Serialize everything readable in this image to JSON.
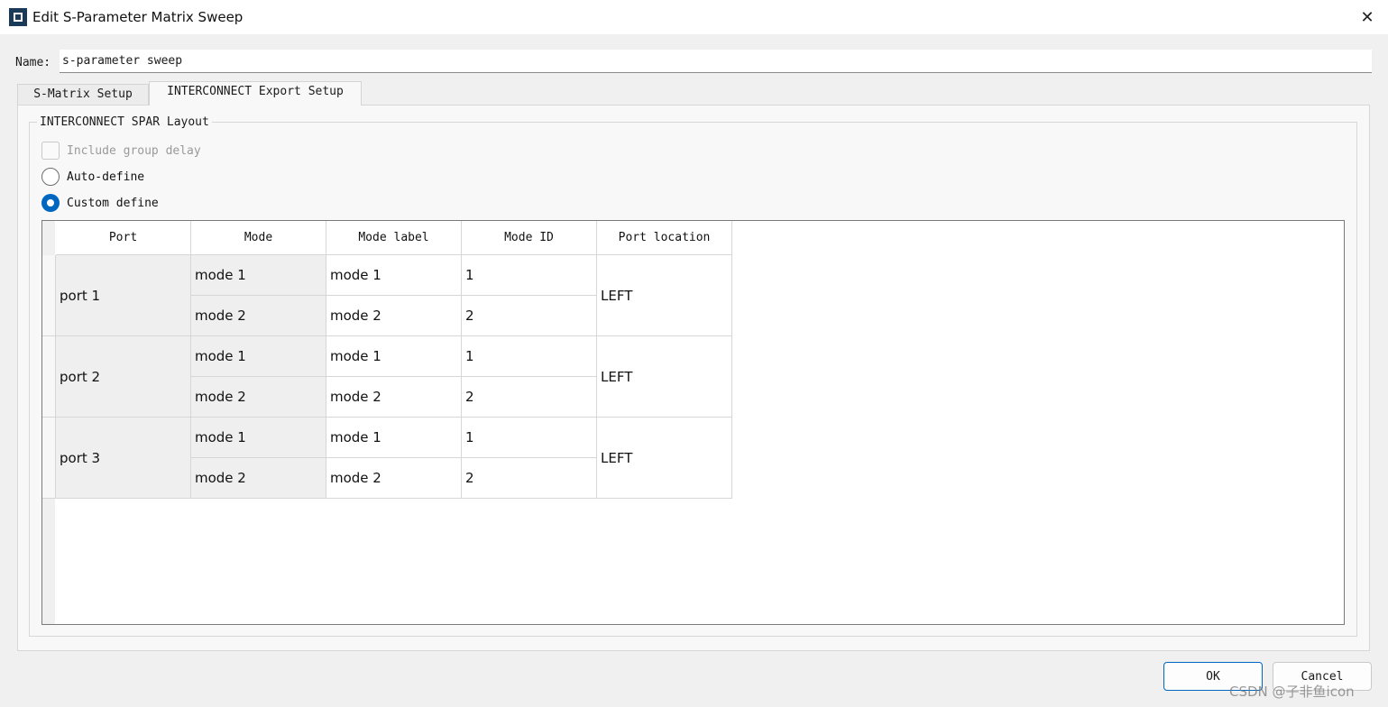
{
  "window": {
    "title": "Edit S-Parameter Matrix Sweep",
    "close_glyph": "✕"
  },
  "name_field": {
    "label": "Name:",
    "value": "s-parameter sweep"
  },
  "tabs": [
    {
      "label": "S-Matrix Setup",
      "active": false
    },
    {
      "label": "INTERCONNECT Export Setup",
      "active": true
    }
  ],
  "layout_group": {
    "title": "INTERCONNECT SPAR Layout",
    "include_group_delay": {
      "label": "Include group delay",
      "checked": false,
      "enabled": false
    },
    "auto_define": {
      "label": "Auto-define",
      "selected": false
    },
    "custom_define": {
      "label": "Custom define",
      "selected": true
    }
  },
  "table": {
    "columns": [
      "Port",
      "Mode",
      "Mode label",
      "Mode ID",
      "Port location"
    ],
    "rows": [
      {
        "port": "port 1",
        "location": "LEFT",
        "modes": [
          {
            "mode": "mode 1",
            "label": "mode 1",
            "id": "1"
          },
          {
            "mode": "mode 2",
            "label": "mode 2",
            "id": "2"
          }
        ]
      },
      {
        "port": "port 2",
        "location": "LEFT",
        "modes": [
          {
            "mode": "mode 1",
            "label": "mode 1",
            "id": "1"
          },
          {
            "mode": "mode 2",
            "label": "mode 2",
            "id": "2"
          }
        ]
      },
      {
        "port": "port 3",
        "location": "LEFT",
        "modes": [
          {
            "mode": "mode 1",
            "label": "mode 1",
            "id": "1"
          },
          {
            "mode": "mode 2",
            "label": "mode 2",
            "id": "2"
          }
        ]
      }
    ]
  },
  "buttons": {
    "ok": "OK",
    "cancel": "Cancel"
  },
  "watermark": "CSDN @子非鱼icon",
  "colors": {
    "accent": "#0067c0",
    "app_icon": "#1b3a57"
  }
}
